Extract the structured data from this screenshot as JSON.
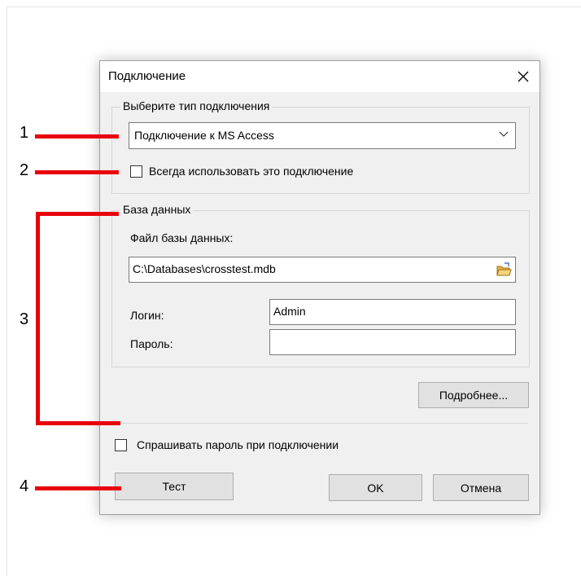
{
  "dialog": {
    "title": "Подключение",
    "connection_group": {
      "legend": "Выберите тип подключения",
      "selected_type": "Подключение к MS Access",
      "always_use_label": "Всегда использовать это подключение",
      "always_use_checked": false
    },
    "database_group": {
      "legend": "База данных",
      "file_label": "Файл базы данных:",
      "file_value": "C:\\Databases\\crosstest.mdb",
      "login_label": "Логин:",
      "login_value": "Admin",
      "password_label": "Пароль:",
      "password_value": ""
    },
    "details_button": "Подробнее...",
    "ask_password_label": "Спрашивать пароль при подключении",
    "ask_password_checked": false,
    "test_button": "Тест",
    "ok_button": "OK",
    "cancel_button": "Отмена"
  },
  "annotations": {
    "n1": "1",
    "n2": "2",
    "n3": "3",
    "n4": "4",
    "color": "#e8000b"
  },
  "icons": {
    "close": "close-icon",
    "dropdown": "chevron-down-icon",
    "browse": "folder-icon"
  }
}
